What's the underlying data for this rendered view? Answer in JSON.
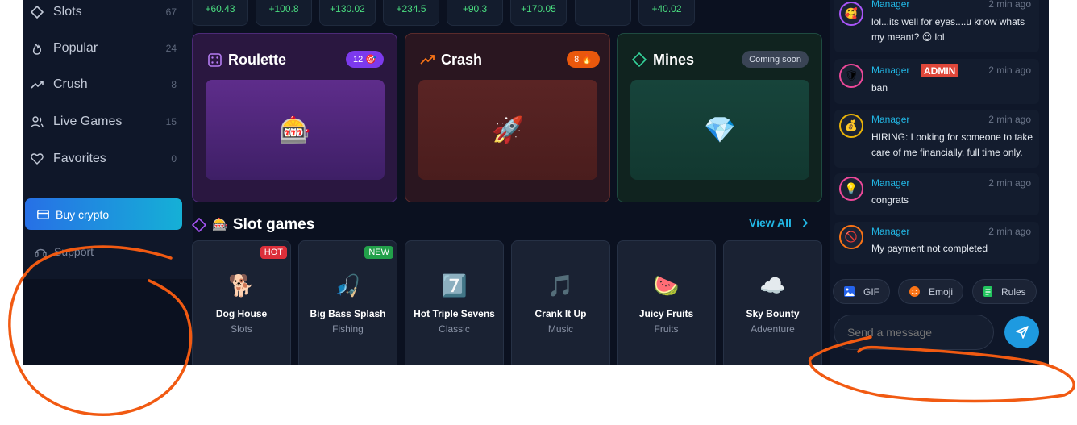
{
  "sidebar": {
    "items": [
      {
        "label": "Slots",
        "count": "67",
        "icon": "slot-icon"
      },
      {
        "label": "Popular",
        "count": "24",
        "icon": "flame-icon"
      },
      {
        "label": "Crush",
        "count": "8",
        "icon": "trend-icon"
      },
      {
        "label": "Live Games",
        "count": "15",
        "icon": "users-icon"
      },
      {
        "label": "Favorites",
        "count": "0",
        "icon": "heart-icon"
      }
    ],
    "buy_crypto": "Buy crypto",
    "support": "Support"
  },
  "ticker": [
    "+60.43",
    "+100.8",
    "+130.02",
    "+234.5",
    "+90.3",
    "+170.05",
    "+40.02"
  ],
  "games": [
    {
      "title": "Roulette",
      "badge": "12 🎯",
      "icon": "dice-icon",
      "art": "🎰"
    },
    {
      "title": "Crash",
      "badge": "8 🔥",
      "icon": "trend-up-icon",
      "art": "🚀"
    },
    {
      "title": "Mines",
      "badge": "Coming soon",
      "icon": "diamond-icon",
      "art": "💎"
    }
  ],
  "slot_section": {
    "title": "Slot games",
    "view_all": "View All"
  },
  "slots": [
    {
      "name": "Dog House",
      "category": "Slots",
      "emoji": "🐕",
      "tag": "HOT",
      "tag_color": "#dc2f3a"
    },
    {
      "name": "Big Bass Splash",
      "category": "Fishing",
      "emoji": "🎣",
      "tag": "NEW",
      "tag_color": "#22a04a"
    },
    {
      "name": "Hot Triple Sevens",
      "category": "Classic",
      "emoji": "7️⃣",
      "tag": "",
      "tag_color": ""
    },
    {
      "name": "Crank It Up",
      "category": "Music",
      "emoji": "🎵",
      "tag": "",
      "tag_color": ""
    },
    {
      "name": "Juicy Fruits",
      "category": "Fruits",
      "emoji": "🍉",
      "tag": "",
      "tag_color": ""
    },
    {
      "name": "Sky Bounty",
      "category": "Adventure",
      "emoji": "☁️",
      "tag": "",
      "tag_color": ""
    }
  ],
  "chat": {
    "messages": [
      {
        "user": "Manager",
        "time": "2 min ago",
        "text": "lol...its well for eyes....u know whats my meant? 😍 lol",
        "avatar": "🥰",
        "ring": "#a855f7",
        "admin": ""
      },
      {
        "user": "Manager",
        "time": "2 min ago",
        "text": "ban",
        "avatar": "🛡",
        "ring": "#ec4899",
        "admin": "ADMIN"
      },
      {
        "user": "Manager",
        "time": "2 min ago",
        "text": "HIRING: Looking for someone to take care of me financially. full time only.",
        "avatar": "💰",
        "ring": "#eab308",
        "admin": ""
      },
      {
        "user": "Manager",
        "time": "2 min ago",
        "text": "congrats",
        "avatar": "💡",
        "ring": "#ec4899",
        "admin": ""
      },
      {
        "user": "Manager",
        "time": "2 min ago",
        "text": "My payment not completed",
        "avatar": "🚫",
        "ring": "#f97316",
        "admin": ""
      }
    ],
    "buttons": {
      "gif": "GIF",
      "emoji": "Emoji",
      "rules": "Rules"
    },
    "input_placeholder": "Send a message"
  }
}
